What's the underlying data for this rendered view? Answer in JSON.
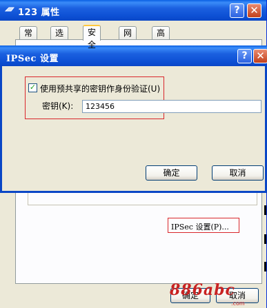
{
  "back_window": {
    "title": "123 属性",
    "help_glyph": "?",
    "close_glyph": "✕",
    "tabs": [
      {
        "label": "常规"
      },
      {
        "label": "选项"
      },
      {
        "label": "安全"
      },
      {
        "label": "网络"
      },
      {
        "label": "高级"
      }
    ],
    "active_tab": "安全",
    "ipsec_settings_button": "IPSec 设置(P)...",
    "ok_button": "确定",
    "cancel_button": "取消"
  },
  "ipsec_dialog": {
    "title": "IPSec 设置",
    "help_glyph": "?",
    "close_glyph": "✕",
    "preshared_key_checkbox": {
      "label": "使用预共享的密钥作身份验证(U)",
      "checked": true
    },
    "key_label": "密钥(K):",
    "key_value": "123456",
    "ok_button": "确定",
    "cancel_button": "取消"
  },
  "colors": {
    "titlebar_blue": "#0A46C6",
    "dialog_face": "#ECE9D8",
    "highlight_red": "#D9262B"
  },
  "watermark": {
    "text": "886abc",
    "suffix": ".com"
  }
}
